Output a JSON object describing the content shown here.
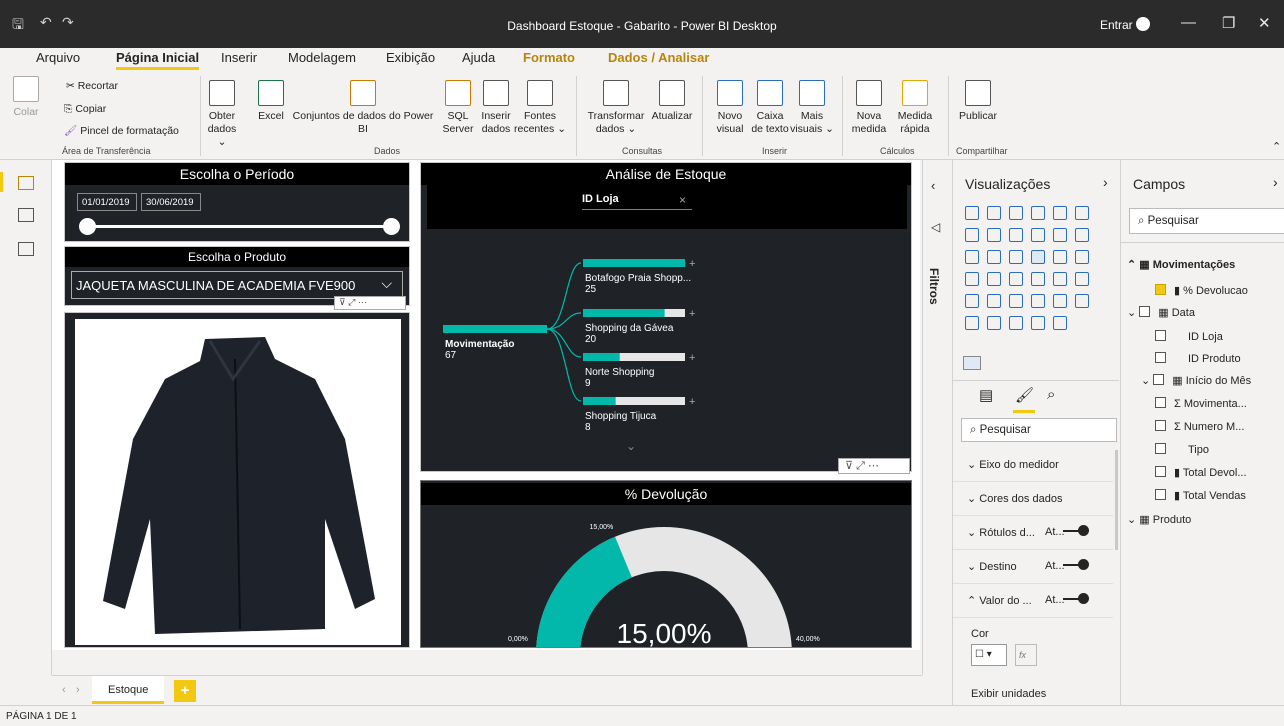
{
  "window": {
    "title": "Dashboard Estoque - Gabarito - Power BI Desktop",
    "signin": "Entrar"
  },
  "menu_tabs": [
    "Arquivo",
    "Página Inicial",
    "Inserir",
    "Modelagem",
    "Exibição",
    "Ajuda",
    "Formato",
    "Dados / Analisar"
  ],
  "ribbon": {
    "clipboard": {
      "paste": "Colar",
      "cut": "Recortar",
      "copy": "Copiar",
      "format_painter": "Pincel de formatação",
      "group": "Área de Transferência"
    },
    "data": {
      "get_data": "Obter dados ⌄",
      "excel": "Excel",
      "datasets": "Conjuntos de dados do Power BI",
      "sql": "SQL Server",
      "enter_data": "Inserir dados",
      "recent": "Fontes recentes ⌄",
      "group": "Dados"
    },
    "queries": {
      "transform": "Transformar dados ⌄",
      "refresh": "Atualizar",
      "group": "Consultas"
    },
    "insert": {
      "new_visual": "Novo visual",
      "text_box": "Caixa de texto",
      "more_visuals": "Mais visuais ⌄",
      "group": "Inserir"
    },
    "calc": {
      "new_measure": "Nova medida",
      "quick_measure": "Medida rápida",
      "group": "Cálculos"
    },
    "share": {
      "publish": "Publicar",
      "group": "Compartilhar"
    }
  },
  "slicer_period": {
    "title": "Escolha o Período",
    "start": "01/01/2019",
    "end": "30/06/2019"
  },
  "slicer_product": {
    "title": "Escolha o Produto",
    "selected": "JAQUETA MASCULINA DE ACADEMIA FVE900"
  },
  "decomp": {
    "title": "Análise de Estoque",
    "level": "ID Loja",
    "close": "×",
    "root": {
      "label": "Movimentação",
      "value": "67"
    },
    "nodes": [
      {
        "label": "Botafogo Praia Shopp...",
        "value": "25",
        "fill": 1.0
      },
      {
        "label": "Shopping da Gávea",
        "value": "20",
        "fill": 0.8
      },
      {
        "label": "Norte Shopping",
        "value": "9",
        "fill": 0.36
      },
      {
        "label": "Shopping Tijuca",
        "value": "8",
        "fill": 0.32
      }
    ]
  },
  "gauge": {
    "title": "% Devolução",
    "value": 15.0,
    "value_label": "15,00%",
    "min_label": "0,00%",
    "max_label": "40,00%",
    "target_label": "15,00%",
    "min": 0,
    "max": 40
  },
  "visualizations": {
    "title": "Visualizações",
    "search": "Pesquisar",
    "sections": [
      "Eixo do medidor",
      "Cores dos dados",
      "Rótulos d...",
      "Destino",
      "Valor do ..."
    ],
    "section_values": [
      "",
      "",
      "At...",
      "At...",
      "At..."
    ],
    "color_label": "Cor",
    "units_label": "Exibir unidades",
    "fx": "fx"
  },
  "filters_label": "Filtros",
  "fields": {
    "title": "Campos",
    "search": "Pesquisar",
    "tables": [
      {
        "name": "Movimentações",
        "items": [
          "% Devolucao"
        ]
      },
      {
        "name": "Data",
        "items": [
          "ID Loja",
          "ID Produto"
        ]
      },
      {
        "name": "Início do Mês",
        "items": [
          "Movimenta...",
          "Numero M...",
          "Tipo",
          "Total Devol...",
          "Total Vendas"
        ]
      },
      {
        "name": "Produto",
        "items": []
      }
    ]
  },
  "page_tab": "Estoque",
  "status": "PÁGINA 1 DE 1",
  "colors": {
    "teal": "#01b8aa",
    "dark": "#1f2328",
    "accent": "#f2c811"
  }
}
